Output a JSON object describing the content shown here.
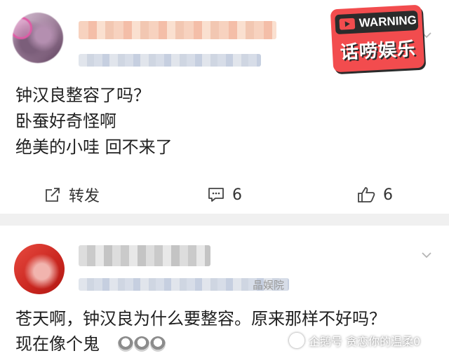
{
  "post1": {
    "text_lines": [
      "钟汉良整容了吗？",
      "卧蚕好奇怪啊",
      "绝美的小哇 回不来了"
    ],
    "actions": {
      "repost_label": "转发",
      "comment_count": "6",
      "like_count": "6"
    }
  },
  "badge": {
    "warning_text": "WARNING",
    "brand_text": "话唠娱乐"
  },
  "post2": {
    "meta_suffix": "晶娱院",
    "text_line1": "苍天啊，钟汉良为什么要整容。原来那样不好吗？",
    "text_line2": "现在像个鬼"
  },
  "watermark": {
    "text": "企鹅号 贪恋你的温柔0"
  },
  "icons": [
    "repost-icon",
    "comment-icon",
    "like-icon",
    "chevron-down-icon",
    "warning-play-icon"
  ],
  "colors": {
    "badge_red": "#f24c4e",
    "divider_gray": "#f0f0f0",
    "text_dark": "#1f1f1f"
  }
}
